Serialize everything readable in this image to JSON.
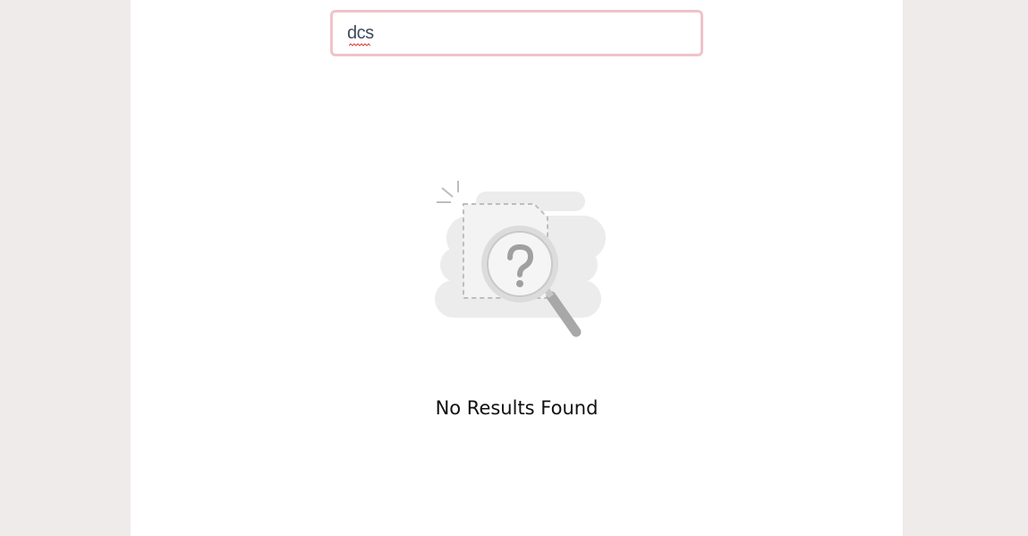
{
  "search": {
    "value": "dcs",
    "spellcheck_marked": true
  },
  "empty_state": {
    "icon": "magnifier-question-icon",
    "message": "No Results Found"
  },
  "colors": {
    "page_background": "#efebea",
    "panel_background": "#ffffff",
    "search_border": "#f0c3c9",
    "message_text": "#111111",
    "illustration_gray": "#d6d6d6"
  }
}
